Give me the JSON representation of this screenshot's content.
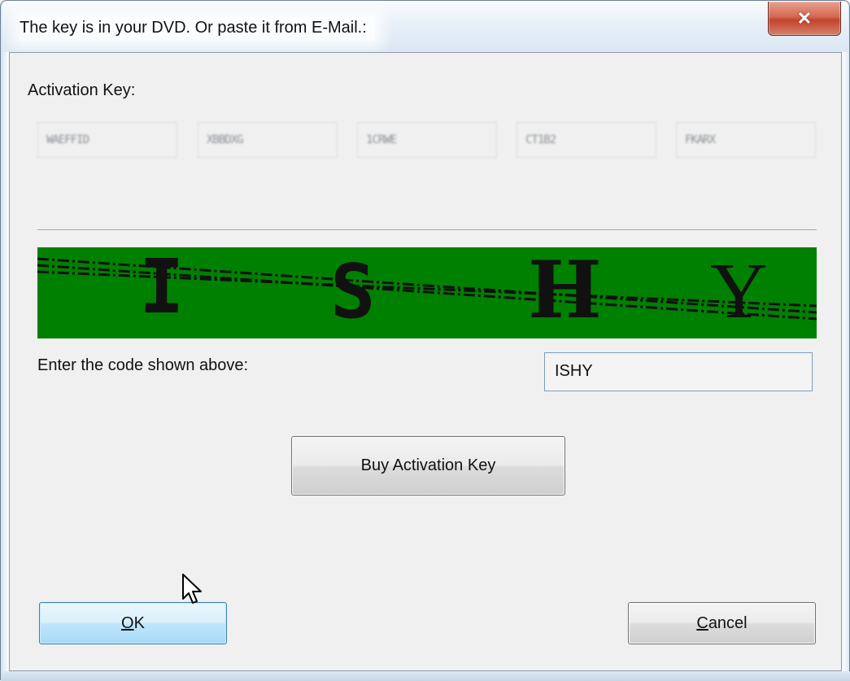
{
  "window": {
    "title": "The key is in your DVD. Or paste it from E-Mail.:",
    "close_icon": "close-icon"
  },
  "activation": {
    "label": "Activation Key:",
    "key_parts": [
      "WAEFFID",
      "XBBDXG",
      "1CRWE",
      "CT1B2",
      "FKARX"
    ]
  },
  "captcha": {
    "text": "ISHY",
    "letters": [
      "I",
      "S",
      "H",
      "Y"
    ],
    "background_color": "#008000",
    "text_color": "#111111"
  },
  "code_entry": {
    "label": "Enter the code shown above:",
    "value": "ISHY"
  },
  "buttons": {
    "buy": "Buy Activation Key",
    "ok": "OK",
    "ok_mnemonic": "O",
    "ok_rest": "K",
    "cancel": "Cancel",
    "cancel_mnemonic": "C",
    "cancel_rest": "ancel"
  },
  "cursor": {
    "icon": "arrow-cursor-icon"
  }
}
